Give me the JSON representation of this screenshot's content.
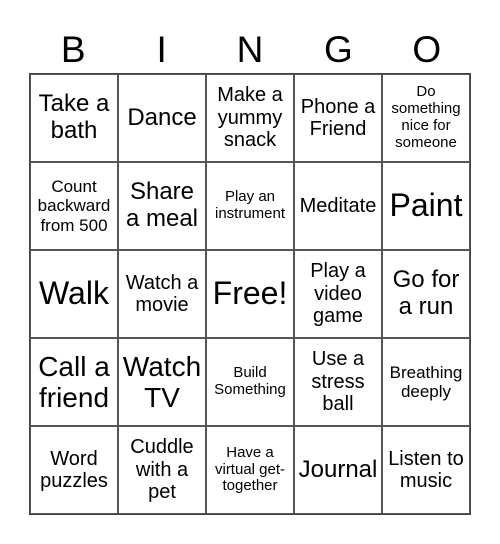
{
  "header": {
    "letters": [
      "B",
      "I",
      "N",
      "G",
      "O"
    ]
  },
  "cells": [
    "Take a bath",
    "Dance",
    "Make a yummy snack",
    "Phone a Friend",
    "Do something nice for someone",
    "Count backward from 500",
    "Share a meal",
    "Play an instrument",
    "Meditate",
    "Paint",
    "Walk",
    "Watch a movie",
    "Free!",
    "Play a video game",
    "Go for a run",
    "Call a friend",
    "Watch TV",
    "Build Something",
    "Use a stress ball",
    "Breathing deeply",
    "Word puzzles",
    "Cuddle with a pet",
    "Have a virtual get-together",
    "Journal",
    "Listen to music"
  ]
}
